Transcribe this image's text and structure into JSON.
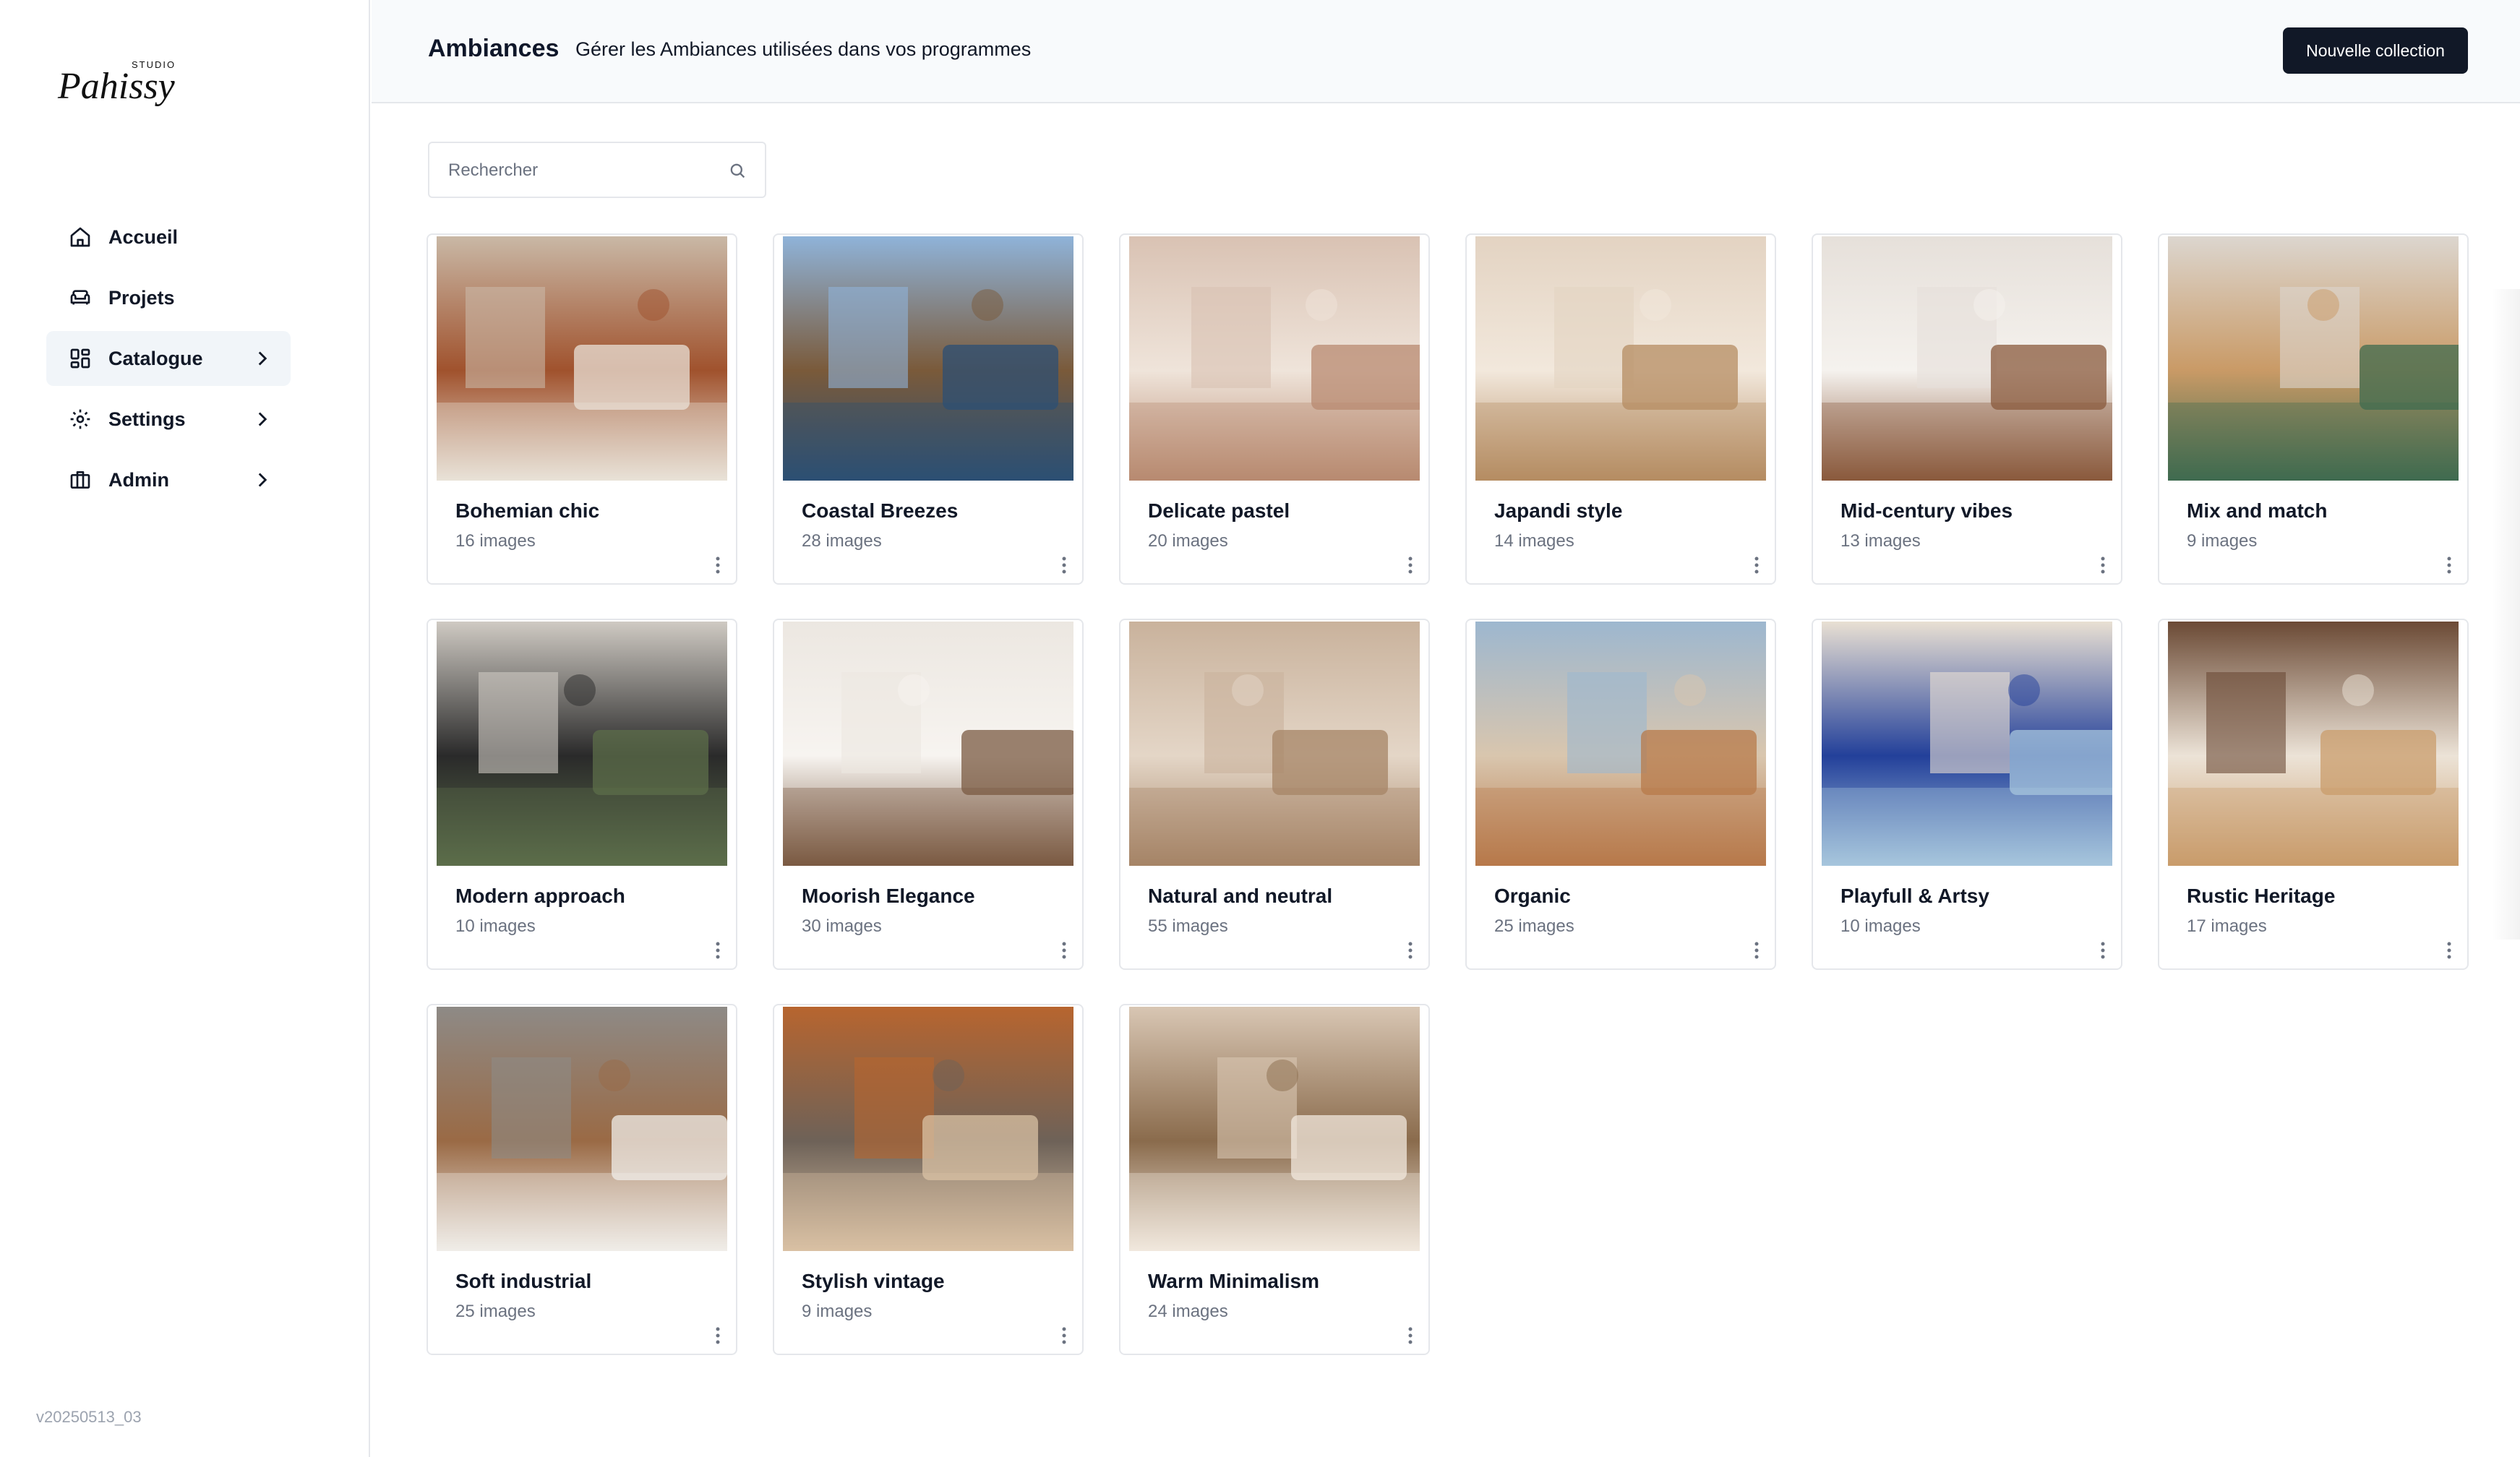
{
  "brand": {
    "logo_script": "Pahissy",
    "logo_small": "STUDIO"
  },
  "sidebar": {
    "items": [
      {
        "label": "Accueil",
        "icon": "home-icon",
        "active": false,
        "chevron": false
      },
      {
        "label": "Projets",
        "icon": "sofa-icon",
        "active": false,
        "chevron": false
      },
      {
        "label": "Catalogue",
        "icon": "grid-icon",
        "active": true,
        "chevron": true
      },
      {
        "label": "Settings",
        "icon": "gear-icon",
        "active": false,
        "chevron": true
      },
      {
        "label": "Admin",
        "icon": "briefcase-icon",
        "active": false,
        "chevron": true
      }
    ],
    "version": "v20250513_03"
  },
  "header": {
    "title": "Ambiances",
    "subtitle": "Gérer les Ambiances utilisées dans vos programmes",
    "new_button": "Nouvelle collection"
  },
  "search": {
    "placeholder": "Rechercher",
    "value": ""
  },
  "collections": [
    {
      "name": "Bohemian chic",
      "count": "16 images",
      "palette": [
        "#c9b8a6",
        "#e9e2d8",
        "#a0522d"
      ]
    },
    {
      "name": "Coastal Breezes",
      "count": "28 images",
      "palette": [
        "#8fb3d9",
        "#2c4f74",
        "#7a5a3a"
      ]
    },
    {
      "name": "Delicate pastel",
      "count": "20 images",
      "palette": [
        "#d9c2b3",
        "#b88a70",
        "#efe4da"
      ]
    },
    {
      "name": "Japandi style",
      "count": "14 images",
      "palette": [
        "#e3d3c2",
        "#b58c62",
        "#f2e8dc"
      ]
    },
    {
      "name": "Mid-century vibes",
      "count": "13 images",
      "palette": [
        "#e6e0da",
        "#8a5a3c",
        "#f5f2ee"
      ]
    },
    {
      "name": "Mix and match",
      "count": "9 images",
      "palette": [
        "#dcd6cf",
        "#3f6b4f",
        "#c99a66"
      ]
    },
    {
      "name": "Modern approach",
      "count": "10 images",
      "palette": [
        "#cfcac3",
        "#5c6e4a",
        "#2a2a2a"
      ]
    },
    {
      "name": "Moorish Elegance",
      "count": "30 images",
      "palette": [
        "#ece7e1",
        "#7a5a42",
        "#f7f4f0"
      ]
    },
    {
      "name": "Natural and neutral",
      "count": "55 images",
      "palette": [
        "#c9b29c",
        "#a58466",
        "#e4d6c7"
      ]
    },
    {
      "name": "Organic",
      "count": "25 images",
      "palette": [
        "#9db7cf",
        "#b7794a",
        "#d9c6ae"
      ]
    },
    {
      "name": "Playfull & Artsy",
      "count": "10 images",
      "palette": [
        "#e9e0d3",
        "#a7c6dd",
        "#23409a"
      ]
    },
    {
      "name": "Rustic Heritage",
      "count": "17 images",
      "palette": [
        "#6b4a35",
        "#c99c6b",
        "#ece3d7"
      ]
    },
    {
      "name": "Soft industrial",
      "count": "25 images",
      "palette": [
        "#8e8a86",
        "#f0ede9",
        "#9a6a45"
      ]
    },
    {
      "name": "Stylish vintage",
      "count": "9 images",
      "palette": [
        "#b7652f",
        "#d9c1a4",
        "#6e6258"
      ]
    },
    {
      "name": "Warm Minimalism",
      "count": "24 images",
      "palette": [
        "#d8c6b3",
        "#f1e8de",
        "#8a6b4c"
      ]
    }
  ],
  "colors": {
    "accent": "#111827",
    "muted": "#6b7280",
    "border": "#e5e7eb",
    "active_bg": "#f1f5f9"
  }
}
